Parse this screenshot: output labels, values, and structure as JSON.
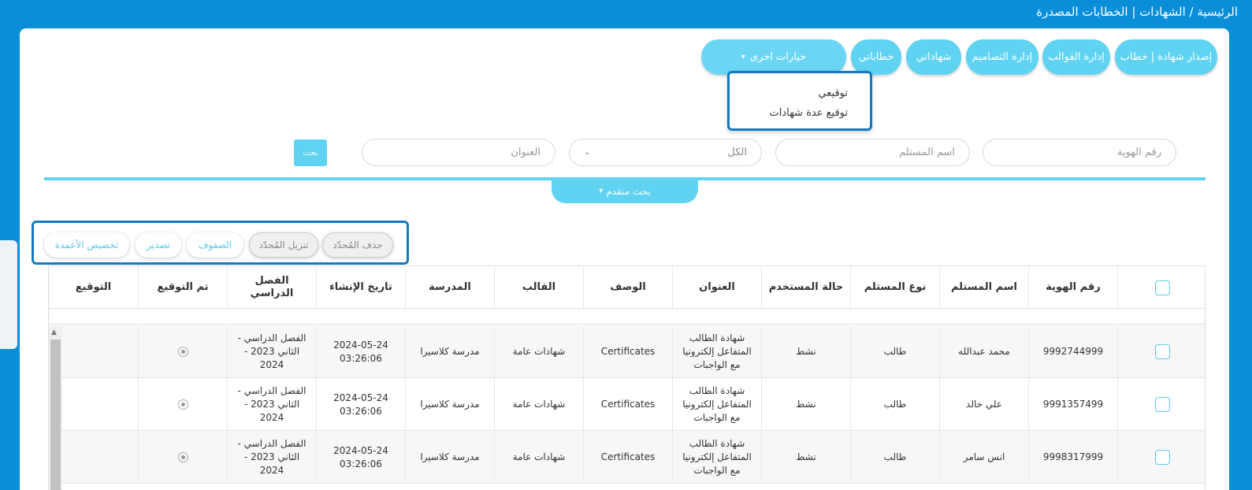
{
  "breadcrumb": "الرئيسية / الشهادات | الخطابات المصدرة",
  "top_buttons": [
    {
      "label": "إصدار شهادة | خطاب"
    },
    {
      "label": "إدارة القوالب"
    },
    {
      "label": "إدارة التصاميم"
    },
    {
      "label": "شهاداتي"
    },
    {
      "label": "خطاباتي"
    }
  ],
  "more_options": {
    "label": "خيارات اخرى",
    "caret": "▾"
  },
  "dropdown": {
    "items": [
      "توقيعي",
      "توقيع عدة شهادات"
    ]
  },
  "filters": {
    "id_placeholder": "رقم الهوية",
    "recipient_placeholder": "اسم المستلم",
    "select_value": "الكل",
    "title_placeholder": "العنوان",
    "search_label": "بحث"
  },
  "advanced_search": {
    "label": "بحث متقدم",
    "caret": "▾"
  },
  "toolbar": {
    "delete_selected": "حذف المُحدّد",
    "download_selected": "تنزيل المُحدّد",
    "rows": "الصفوف",
    "export": "تصدير",
    "customize_columns": "تخصيص الأعمدة"
  },
  "table": {
    "headers": {
      "id": "رقم الهوية",
      "recipient_name": "اسم المستلم",
      "recipient_type": "نوع المستلم",
      "user_status": "حالة المستخدم",
      "title": "العنوان",
      "description": "الوصف",
      "template": "القالب",
      "school": "المدرسة",
      "created_at": "تاريخ الإنشاء",
      "semester": "الفصل الدراسي",
      "signed": "تم التوقيع",
      "signature": "التوقيع"
    },
    "rows": [
      {
        "id": "9992744999",
        "name": "محمد عبدالله",
        "type": "طالب",
        "status": "نشط",
        "title": "شهادة الطالب المتفاعل إلكترونيا مع الواجبات",
        "description": "Certificates",
        "template": "شهادات عامة",
        "school": "مدرسة كلاسيرا",
        "date": "2024-05-24",
        "time": "03:26:06",
        "semester": "الفصل الدراسي - الثاني 2023 - 2024"
      },
      {
        "id": "9991357499",
        "name": "علي خالد",
        "type": "طالب",
        "status": "نشط",
        "title": "شهادة الطالب المتفاعل إلكترونيا مع الواجبات",
        "description": "Certificates",
        "template": "شهادات عامة",
        "school": "مدرسة كلاسيرا",
        "date": "2024-05-24",
        "time": "03:26:06",
        "semester": "الفصل الدراسي - الثاني 2023 - 2024"
      },
      {
        "id": "9998317999",
        "name": "انس سامر",
        "type": "طالب",
        "status": "نشط",
        "title": "شهادة الطالب المتفاعل إلكترونيا مع الواجبات",
        "description": "Certificates",
        "template": "شهادات عامة",
        "school": "مدرسة كلاسيرا",
        "date": "2024-05-24",
        "time": "03:26:06",
        "semester": "الفصل الدراسي - الثاني 2023 - 2024"
      }
    ]
  },
  "colors": {
    "accent": "#5fd3f1",
    "header_bg": "#0b8ed8",
    "highlight_border": "#1479c0"
  }
}
